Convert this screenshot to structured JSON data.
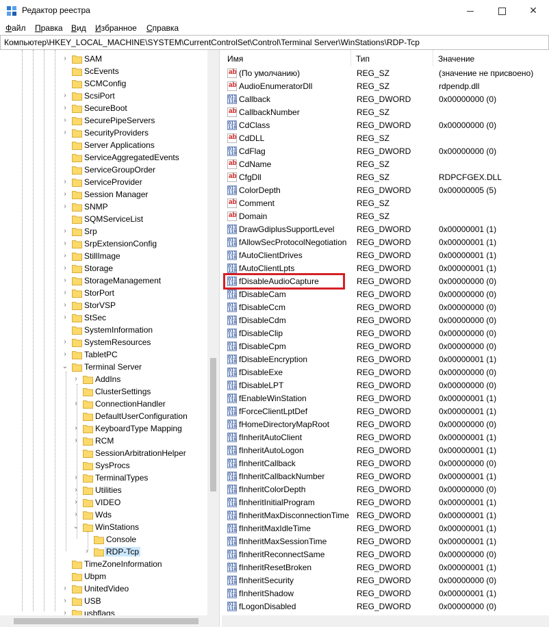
{
  "window": {
    "title": "Редактор реестра",
    "app_icon": "registry-editor-icon",
    "accent_highlight": "#d51f26"
  },
  "menu": [
    {
      "label": "Файл",
      "access_key": "Ф"
    },
    {
      "label": "Правка",
      "access_key": "П"
    },
    {
      "label": "Вид",
      "access_key": "В"
    },
    {
      "label": "Избранное",
      "access_key": "И"
    },
    {
      "label": "Справка",
      "access_key": "С"
    }
  ],
  "address": "Компьютер\\HKEY_LOCAL_MACHINE\\SYSTEM\\CurrentControlSet\\Control\\Terminal Server\\WinStations\\RDP-Tcp",
  "tree": [
    {
      "label": "SAM",
      "level": 0,
      "chevron": "right"
    },
    {
      "label": "ScEvents",
      "level": 0,
      "chevron": "none"
    },
    {
      "label": "SCMConfig",
      "level": 0,
      "chevron": "none"
    },
    {
      "label": "ScsiPort",
      "level": 0,
      "chevron": "right"
    },
    {
      "label": "SecureBoot",
      "level": 0,
      "chevron": "right"
    },
    {
      "label": "SecurePipeServers",
      "level": 0,
      "chevron": "right"
    },
    {
      "label": "SecurityProviders",
      "level": 0,
      "chevron": "right"
    },
    {
      "label": "Server Applications",
      "level": 0,
      "chevron": "none"
    },
    {
      "label": "ServiceAggregatedEvents",
      "level": 0,
      "chevron": "none"
    },
    {
      "label": "ServiceGroupOrder",
      "level": 0,
      "chevron": "none"
    },
    {
      "label": "ServiceProvider",
      "level": 0,
      "chevron": "right"
    },
    {
      "label": "Session Manager",
      "level": 0,
      "chevron": "right"
    },
    {
      "label": "SNMP",
      "level": 0,
      "chevron": "right"
    },
    {
      "label": "SQMServiceList",
      "level": 0,
      "chevron": "none"
    },
    {
      "label": "Srp",
      "level": 0,
      "chevron": "right"
    },
    {
      "label": "SrpExtensionConfig",
      "level": 0,
      "chevron": "right"
    },
    {
      "label": "StillImage",
      "level": 0,
      "chevron": "right"
    },
    {
      "label": "Storage",
      "level": 0,
      "chevron": "right"
    },
    {
      "label": "StorageManagement",
      "level": 0,
      "chevron": "right"
    },
    {
      "label": "StorPort",
      "level": 0,
      "chevron": "right"
    },
    {
      "label": "StorVSP",
      "level": 0,
      "chevron": "right"
    },
    {
      "label": "StSec",
      "level": 0,
      "chevron": "right"
    },
    {
      "label": "SystemInformation",
      "level": 0,
      "chevron": "none"
    },
    {
      "label": "SystemResources",
      "level": 0,
      "chevron": "right"
    },
    {
      "label": "TabletPC",
      "level": 0,
      "chevron": "right"
    },
    {
      "label": "Terminal Server",
      "level": 0,
      "chevron": "down"
    },
    {
      "label": "AddIns",
      "level": 1,
      "chevron": "right"
    },
    {
      "label": "ClusterSettings",
      "level": 1,
      "chevron": "none"
    },
    {
      "label": "ConnectionHandler",
      "level": 1,
      "chevron": "right"
    },
    {
      "label": "DefaultUserConfiguration",
      "level": 1,
      "chevron": "none"
    },
    {
      "label": "KeyboardType Mapping",
      "level": 1,
      "chevron": "right"
    },
    {
      "label": "RCM",
      "level": 1,
      "chevron": "right"
    },
    {
      "label": "SessionArbitrationHelper",
      "level": 1,
      "chevron": "none"
    },
    {
      "label": "SysProcs",
      "level": 1,
      "chevron": "none"
    },
    {
      "label": "TerminalTypes",
      "level": 1,
      "chevron": "right"
    },
    {
      "label": "Utilities",
      "level": 1,
      "chevron": "right"
    },
    {
      "label": "VIDEO",
      "level": 1,
      "chevron": "right"
    },
    {
      "label": "Wds",
      "level": 1,
      "chevron": "right"
    },
    {
      "label": "WinStations",
      "level": 1,
      "chevron": "down"
    },
    {
      "label": "Console",
      "level": 2,
      "chevron": "none"
    },
    {
      "label": "RDP-Tcp",
      "level": 2,
      "chevron": "right",
      "selected": true
    },
    {
      "label": "TimeZoneInformation",
      "level": 0,
      "chevron": "none"
    },
    {
      "label": "Ubpm",
      "level": 0,
      "chevron": "none"
    },
    {
      "label": "UnitedVideo",
      "level": 0,
      "chevron": "right"
    },
    {
      "label": "USB",
      "level": 0,
      "chevron": "right"
    },
    {
      "label": "usbflags",
      "level": 0,
      "chevron": "right"
    }
  ],
  "columns": {
    "name": "Имя",
    "type": "Тип",
    "value": "Значение"
  },
  "values": [
    {
      "name": "(По умолчанию)",
      "type": "REG_SZ",
      "data": "(значение не присвоено)",
      "icon": "ab"
    },
    {
      "name": "AudioEnumeratorDll",
      "type": "REG_SZ",
      "data": "rdpendp.dll",
      "icon": "ab"
    },
    {
      "name": "Callback",
      "type": "REG_DWORD",
      "data": "0x00000000 (0)",
      "icon": "bin"
    },
    {
      "name": "CallbackNumber",
      "type": "REG_SZ",
      "data": "",
      "icon": "ab"
    },
    {
      "name": "CdClass",
      "type": "REG_DWORD",
      "data": "0x00000000 (0)",
      "icon": "bin"
    },
    {
      "name": "CdDLL",
      "type": "REG_SZ",
      "data": "",
      "icon": "ab"
    },
    {
      "name": "CdFlag",
      "type": "REG_DWORD",
      "data": "0x00000000 (0)",
      "icon": "bin"
    },
    {
      "name": "CdName",
      "type": "REG_SZ",
      "data": "",
      "icon": "ab"
    },
    {
      "name": "CfgDll",
      "type": "REG_SZ",
      "data": "RDPCFGEX.DLL",
      "icon": "ab"
    },
    {
      "name": "ColorDepth",
      "type": "REG_DWORD",
      "data": "0x00000005 (5)",
      "icon": "bin"
    },
    {
      "name": "Comment",
      "type": "REG_SZ",
      "data": "",
      "icon": "ab"
    },
    {
      "name": "Domain",
      "type": "REG_SZ",
      "data": "",
      "icon": "ab"
    },
    {
      "name": "DrawGdiplusSupportLevel",
      "type": "REG_DWORD",
      "data": "0x00000001 (1)",
      "icon": "bin"
    },
    {
      "name": "fAllowSecProtocolNegotiation",
      "type": "REG_DWORD",
      "data": "0x00000001 (1)",
      "icon": "bin"
    },
    {
      "name": "fAutoClientDrives",
      "type": "REG_DWORD",
      "data": "0x00000001 (1)",
      "icon": "bin"
    },
    {
      "name": "fAutoClientLpts",
      "type": "REG_DWORD",
      "data": "0x00000001 (1)",
      "icon": "bin"
    },
    {
      "name": "fDisableAudioCapture",
      "type": "REG_DWORD",
      "data": "0x00000000 (0)",
      "icon": "bin",
      "highlighted": true
    },
    {
      "name": "fDisableCam",
      "type": "REG_DWORD",
      "data": "0x00000000 (0)",
      "icon": "bin"
    },
    {
      "name": "fDisableCcm",
      "type": "REG_DWORD",
      "data": "0x00000000 (0)",
      "icon": "bin"
    },
    {
      "name": "fDisableCdm",
      "type": "REG_DWORD",
      "data": "0x00000000 (0)",
      "icon": "bin"
    },
    {
      "name": "fDisableClip",
      "type": "REG_DWORD",
      "data": "0x00000000 (0)",
      "icon": "bin"
    },
    {
      "name": "fDisableCpm",
      "type": "REG_DWORD",
      "data": "0x00000000 (0)",
      "icon": "bin"
    },
    {
      "name": "fDisableEncryption",
      "type": "REG_DWORD",
      "data": "0x00000001 (1)",
      "icon": "bin"
    },
    {
      "name": "fDisableExe",
      "type": "REG_DWORD",
      "data": "0x00000000 (0)",
      "icon": "bin"
    },
    {
      "name": "fDisableLPT",
      "type": "REG_DWORD",
      "data": "0x00000000 (0)",
      "icon": "bin"
    },
    {
      "name": "fEnableWinStation",
      "type": "REG_DWORD",
      "data": "0x00000001 (1)",
      "icon": "bin"
    },
    {
      "name": "fForceClientLptDef",
      "type": "REG_DWORD",
      "data": "0x00000001 (1)",
      "icon": "bin"
    },
    {
      "name": "fHomeDirectoryMapRoot",
      "type": "REG_DWORD",
      "data": "0x00000000 (0)",
      "icon": "bin"
    },
    {
      "name": "fInheritAutoClient",
      "type": "REG_DWORD",
      "data": "0x00000001 (1)",
      "icon": "bin"
    },
    {
      "name": "fInheritAutoLogon",
      "type": "REG_DWORD",
      "data": "0x00000001 (1)",
      "icon": "bin"
    },
    {
      "name": "fInheritCallback",
      "type": "REG_DWORD",
      "data": "0x00000000 (0)",
      "icon": "bin"
    },
    {
      "name": "fInheritCallbackNumber",
      "type": "REG_DWORD",
      "data": "0x00000001 (1)",
      "icon": "bin"
    },
    {
      "name": "fInheritColorDepth",
      "type": "REG_DWORD",
      "data": "0x00000000 (0)",
      "icon": "bin"
    },
    {
      "name": "fInheritInitialProgram",
      "type": "REG_DWORD",
      "data": "0x00000001 (1)",
      "icon": "bin"
    },
    {
      "name": "fInheritMaxDisconnectionTime",
      "type": "REG_DWORD",
      "data": "0x00000001 (1)",
      "icon": "bin"
    },
    {
      "name": "fInheritMaxIdleTime",
      "type": "REG_DWORD",
      "data": "0x00000001 (1)",
      "icon": "bin"
    },
    {
      "name": "fInheritMaxSessionTime",
      "type": "REG_DWORD",
      "data": "0x00000001 (1)",
      "icon": "bin"
    },
    {
      "name": "fInheritReconnectSame",
      "type": "REG_DWORD",
      "data": "0x00000000 (0)",
      "icon": "bin"
    },
    {
      "name": "fInheritResetBroken",
      "type": "REG_DWORD",
      "data": "0x00000001 (1)",
      "icon": "bin"
    },
    {
      "name": "fInheritSecurity",
      "type": "REG_DWORD",
      "data": "0x00000000 (0)",
      "icon": "bin"
    },
    {
      "name": "fInheritShadow",
      "type": "REG_DWORD",
      "data": "0x00000001 (1)",
      "icon": "bin"
    },
    {
      "name": "fLogonDisabled",
      "type": "REG_DWORD",
      "data": "0x00000000 (0)",
      "icon": "bin"
    }
  ]
}
